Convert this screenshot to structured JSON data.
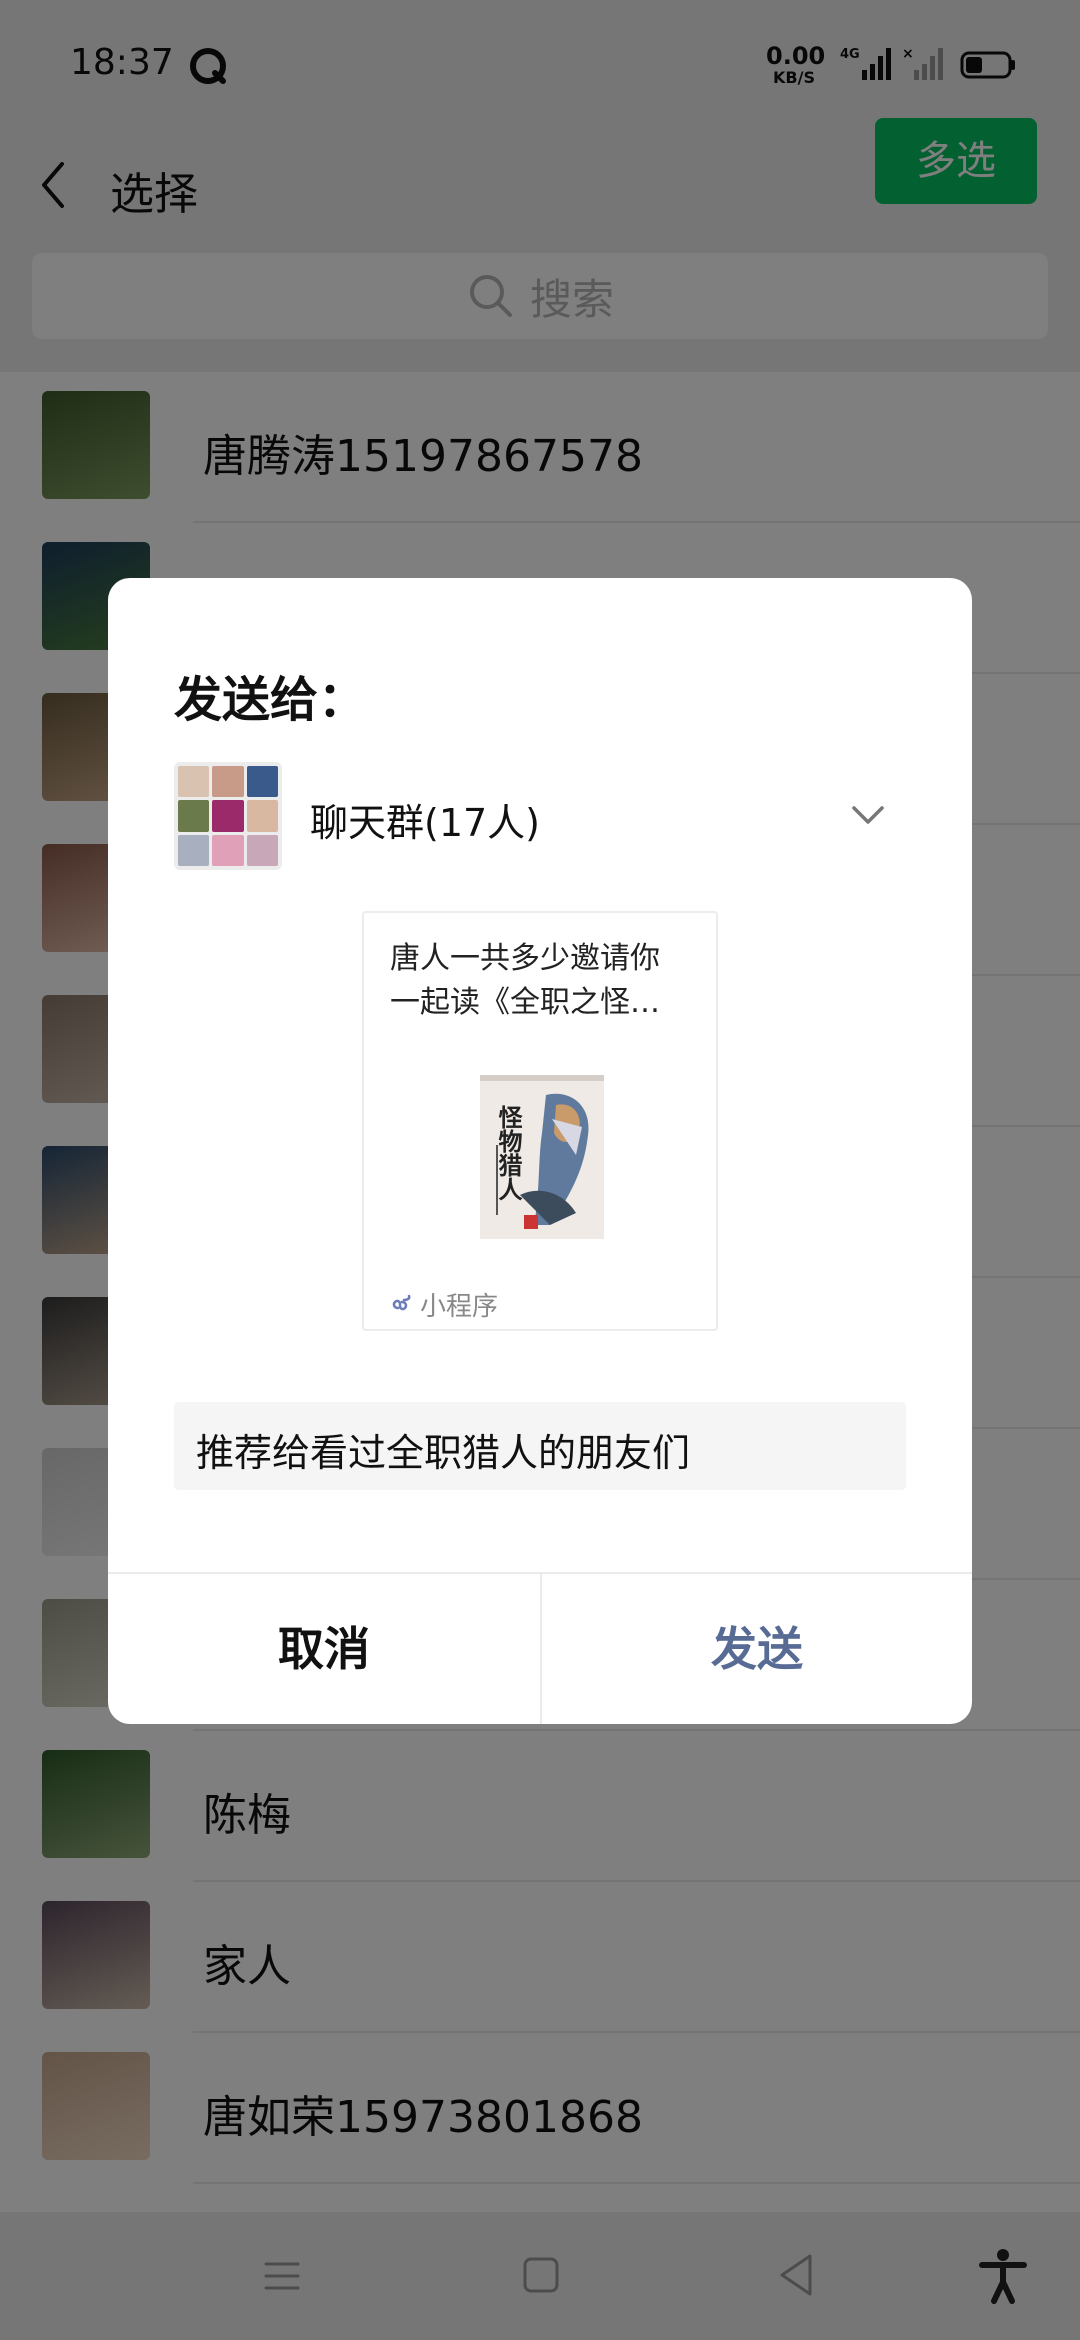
{
  "status_bar": {
    "time": "18:37",
    "net_speed_value": "0.00",
    "net_speed_unit": "KB/S",
    "network_type": "4G"
  },
  "header": {
    "title": "选择",
    "multi_select_label": "多选"
  },
  "search": {
    "placeholder": "搜索"
  },
  "contacts": [
    {
      "name": "唐腾涛15197867578",
      "avatar_colors": [
        "#3e5a2c",
        "#7d9b5e"
      ]
    },
    {
      "name": "",
      "avatar_colors": [
        "#1d3d5c",
        "#4b7d3a"
      ]
    },
    {
      "name": "",
      "avatar_colors": [
        "#6b5a3c",
        "#caa88a"
      ]
    },
    {
      "name": "",
      "avatar_colors": [
        "#8a5a4a",
        "#e8c2b0"
      ]
    },
    {
      "name": "",
      "avatar_colors": [
        "#8a7a6a",
        "#c9b8aa"
      ]
    },
    {
      "name": "",
      "avatar_colors": [
        "#2a4a6c",
        "#c9a98a"
      ]
    },
    {
      "name": "",
      "avatar_colors": [
        "#3a3a3a",
        "#b0a090"
      ]
    },
    {
      "name": "",
      "avatar_colors": [
        "#d0d0d0",
        "#f0f0f0"
      ]
    },
    {
      "name": "",
      "avatar_colors": [
        "#9a9a8a",
        "#d8d8c8"
      ]
    },
    {
      "name": "陈梅",
      "avatar_colors": [
        "#2f5a2a",
        "#8fa878"
      ]
    },
    {
      "name": "家人",
      "avatar_colors": [
        "#5a4a5a",
        "#c8b8a8"
      ]
    },
    {
      "name": "唐如荣15973801868",
      "avatar_colors": [
        "#c8a890",
        "#f0d8c0"
      ]
    }
  ],
  "dialog": {
    "title": "发送给：",
    "recipient": "聊天群(17人)",
    "card_title_line1": "唐人一共多少邀请你",
    "card_title_line2": "一起读《全职之怪…",
    "book_title": "怪物猎人",
    "mini_program_label": "小程序",
    "message": "推荐给看过全职猎人的朋友们",
    "cancel_label": "取消",
    "send_label": "发送"
  },
  "colors": {
    "accent_green": "#07c160",
    "send_blue": "#576b95"
  }
}
